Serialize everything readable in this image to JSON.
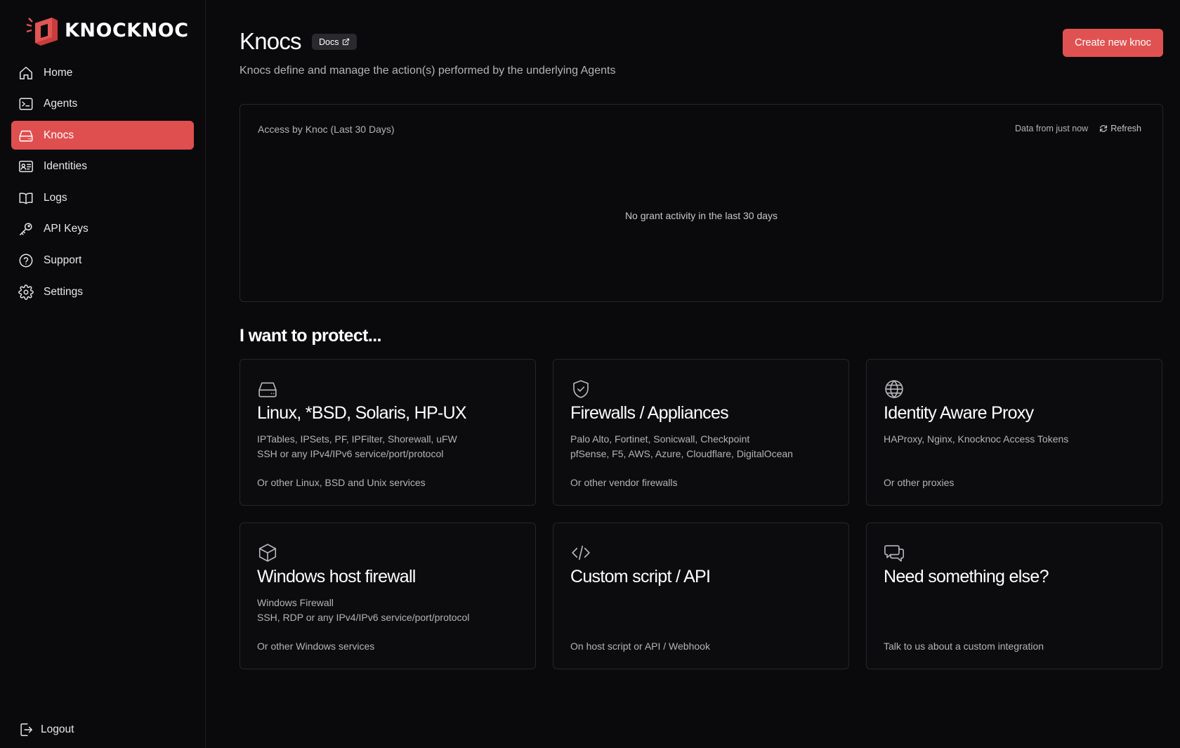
{
  "brand": {
    "name": "KNOCKNOC",
    "accent": "#df4f4f"
  },
  "sidebar": {
    "items": [
      {
        "label": "Home",
        "icon": "home-icon",
        "active": false
      },
      {
        "label": "Agents",
        "icon": "terminal-icon",
        "active": false
      },
      {
        "label": "Knocs",
        "icon": "hard-drive-icon",
        "active": true
      },
      {
        "label": "Identities",
        "icon": "id-card-icon",
        "active": false
      },
      {
        "label": "Logs",
        "icon": "book-open-icon",
        "active": false
      },
      {
        "label": "API Keys",
        "icon": "key-icon",
        "active": false
      },
      {
        "label": "Support",
        "icon": "help-circle-icon",
        "active": false
      },
      {
        "label": "Settings",
        "icon": "gear-icon",
        "active": false
      }
    ],
    "logout_label": "Logout"
  },
  "header": {
    "title": "Knocs",
    "docs_label": "Docs",
    "subtitle": "Knocs define and manage the action(s) performed by the underlying Agents",
    "create_label": "Create new knoc"
  },
  "chart_panel": {
    "title": "Access by Knoc (Last 30 Days)",
    "data_freshness": "Data from just now",
    "refresh_label": "Refresh",
    "empty_message": "No grant activity in the last 30 days"
  },
  "protect": {
    "title": "I want to protect...",
    "cards": [
      {
        "icon": "hard-drive-icon",
        "title": "Linux, *BSD, Solaris, HP-UX",
        "line1": "IPTables, IPSets, PF, IPFilter, Shorewall, uFW",
        "line2": "SSH or any IPv4/IPv6 service/port/protocol",
        "foot": "Or other Linux, BSD and Unix services"
      },
      {
        "icon": "shield-check-icon",
        "title": "Firewalls / Appliances",
        "line1": "Palo Alto, Fortinet, Sonicwall, Checkpoint",
        "line2": "pfSense, F5, AWS, Azure, Cloudflare, DigitalOcean",
        "foot": "Or other vendor firewalls"
      },
      {
        "icon": "globe-icon",
        "title": "Identity Aware Proxy",
        "line1": "HAProxy, Nginx, Knocknoc Access Tokens",
        "line2": "",
        "foot": "Or other proxies"
      },
      {
        "icon": "box-icon",
        "title": "Windows host firewall",
        "line1": "Windows Firewall",
        "line2": "SSH, RDP or any IPv4/IPv6 service/port/protocol",
        "foot": "Or other Windows services"
      },
      {
        "icon": "code-icon",
        "title": "Custom script / API",
        "line1": "",
        "line2": "",
        "foot": "On host script or API / Webhook"
      },
      {
        "icon": "chat-icon",
        "title": "Need something else?",
        "line1": "",
        "line2": "",
        "foot": "Talk to us about a custom integration"
      }
    ]
  }
}
